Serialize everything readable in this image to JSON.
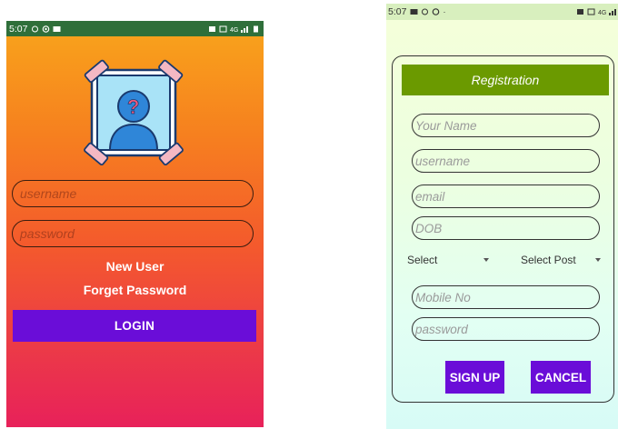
{
  "login_screen": {
    "status_bar": {
      "time": "5:07"
    },
    "username_placeholder": "username",
    "password_placeholder": "password",
    "new_user_label": "New User",
    "forget_password_label": "Forget Password",
    "login_button_label": "LOGIN",
    "avatar_icon": "person-question-icon",
    "colors": {
      "gradient_top": "#f9a51b",
      "gradient_bottom": "#e8215a",
      "button": "#6a0dd8"
    }
  },
  "registration_screen": {
    "status_bar": {
      "time": "5:07"
    },
    "header_title": "Registration",
    "fields": [
      {
        "placeholder": "Your Name"
      },
      {
        "placeholder": "username"
      },
      {
        "placeholder": "email"
      },
      {
        "placeholder": "DOB"
      }
    ],
    "select_gender_value": "Select",
    "select_post_value": "Select Post",
    "mobile_placeholder": "Mobile No",
    "password_placeholder": "password",
    "sign_up_label": "SIGN UP",
    "cancel_label": "CANCEL",
    "colors": {
      "header": "#6b9a00",
      "button": "#6a0dd8"
    }
  }
}
